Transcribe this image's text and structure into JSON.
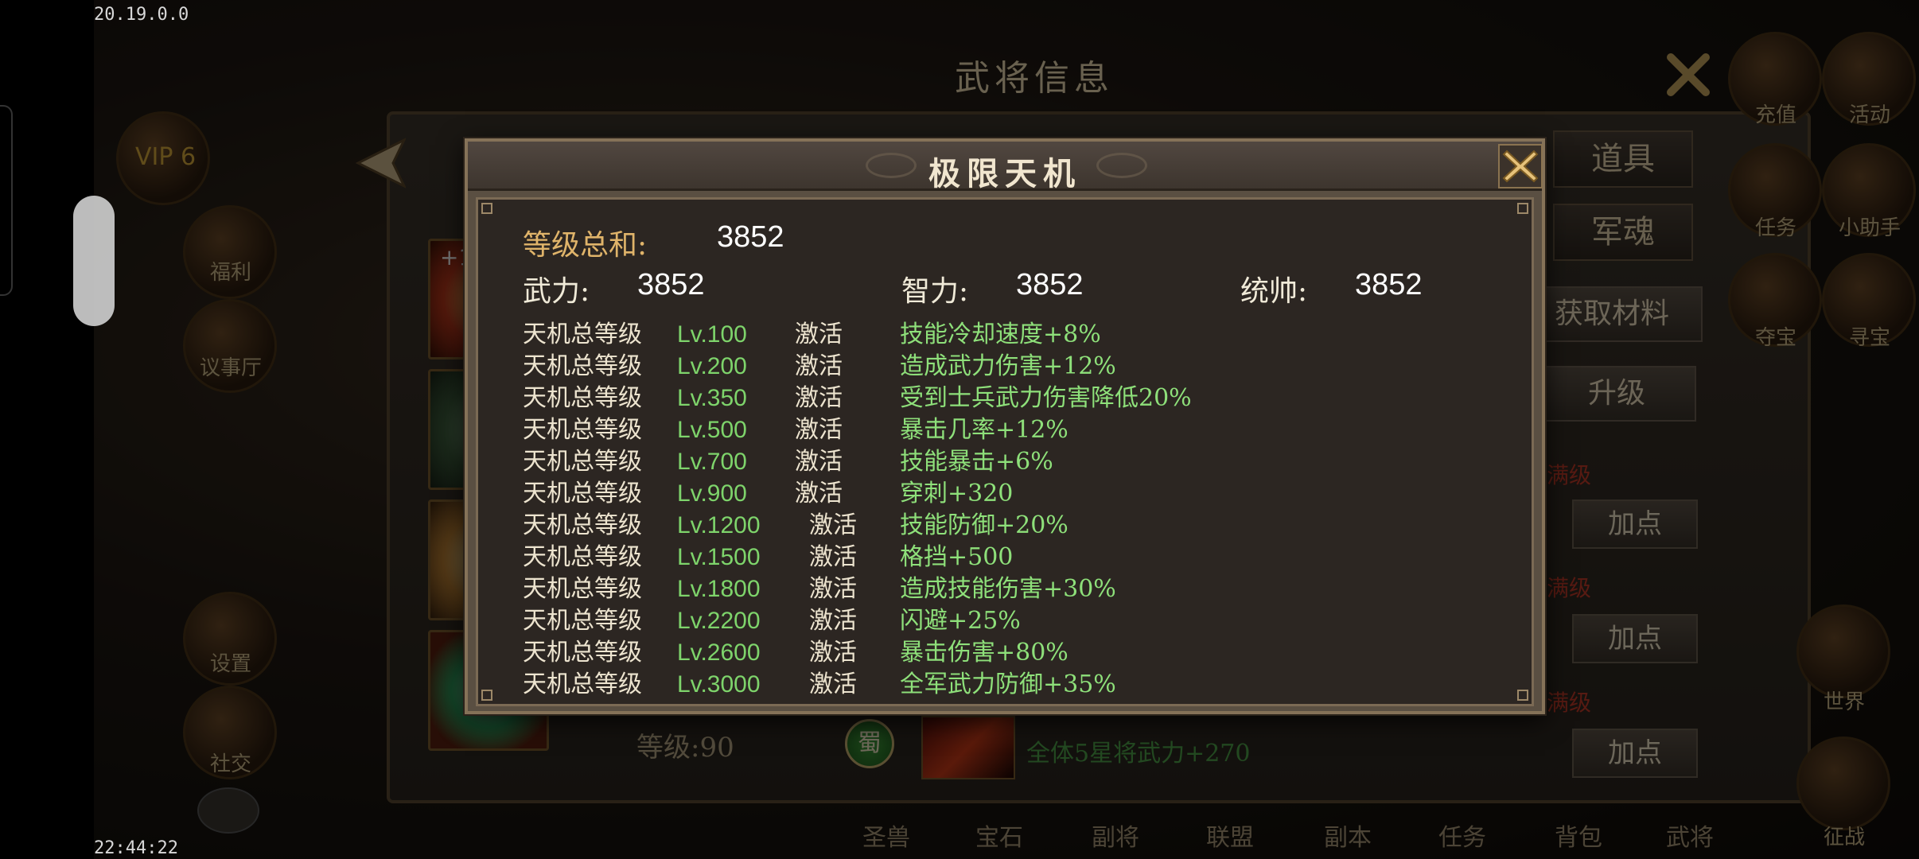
{
  "status_bar": {
    "network_speed": "20.19.0.0",
    "clock": "22:44:22"
  },
  "background": {
    "window_title": "武将信息",
    "vip_label": "VIP 6",
    "left_menu": [
      "福利",
      "议事厅",
      "设置",
      "社交"
    ],
    "right_menu": [
      "充值",
      "活动",
      "任务",
      "小助手",
      "夺宝",
      "寻宝",
      "世界",
      "征战"
    ],
    "tabs": [
      "道具",
      "军魂"
    ],
    "buttons": {
      "get_material": "获取材料",
      "upgrade": "升级",
      "add_point": "加点"
    },
    "max_level_label": "满级",
    "hero_level": "等级:90",
    "faction_badge": "蜀",
    "skill_bonus_text": "全体5星将武力+270",
    "bottom_nav": [
      "圣兽",
      "宝石",
      "副将",
      "联盟",
      "副本",
      "任务",
      "背包",
      "武将"
    ]
  },
  "modal": {
    "title": "极限天机",
    "close_icon": "close-x-icon",
    "total_level_label": "等级总和:",
    "total_level_value": "3852",
    "stats": [
      {
        "label": "武力:",
        "value": "3852"
      },
      {
        "label": "智力:",
        "value": "3852"
      },
      {
        "label": "统帅:",
        "value": "3852"
      }
    ],
    "bonuses": [
      {
        "prefix": "天机总等级",
        "level": "Lv.100",
        "status": "激活",
        "effect": "技能冷却速度+8%"
      },
      {
        "prefix": "天机总等级",
        "level": "Lv.200",
        "status": "激活",
        "effect": "造成武力伤害+12%"
      },
      {
        "prefix": "天机总等级",
        "level": "Lv.350",
        "status": "激活",
        "effect": "受到士兵武力伤害降低20%"
      },
      {
        "prefix": "天机总等级",
        "level": "Lv.500",
        "status": "激活",
        "effect": "暴击几率+12%"
      },
      {
        "prefix": "天机总等级",
        "level": "Lv.700",
        "status": "激活",
        "effect": "技能暴击+6%"
      },
      {
        "prefix": "天机总等级",
        "level": "Lv.900",
        "status": "激活",
        "effect": "穿刺+320"
      },
      {
        "prefix": "天机总等级",
        "level": "Lv.1200",
        "status": "激活",
        "effect": "技能防御+20%"
      },
      {
        "prefix": "天机总等级",
        "level": "Lv.1500",
        "status": "激活",
        "effect": "格挡+500"
      },
      {
        "prefix": "天机总等级",
        "level": "Lv.1800",
        "status": "激活",
        "effect": "造成技能伤害+30%"
      },
      {
        "prefix": "天机总等级",
        "level": "Lv.2200",
        "status": "激活",
        "effect": "闪避+25%"
      },
      {
        "prefix": "天机总等级",
        "level": "Lv.2600",
        "status": "激活",
        "effect": "暴击伤害+80%"
      },
      {
        "prefix": "天机总等级",
        "level": "Lv.3000",
        "status": "激活",
        "effect": "全军武力防御+35%"
      }
    ]
  },
  "card_badge": "+1"
}
